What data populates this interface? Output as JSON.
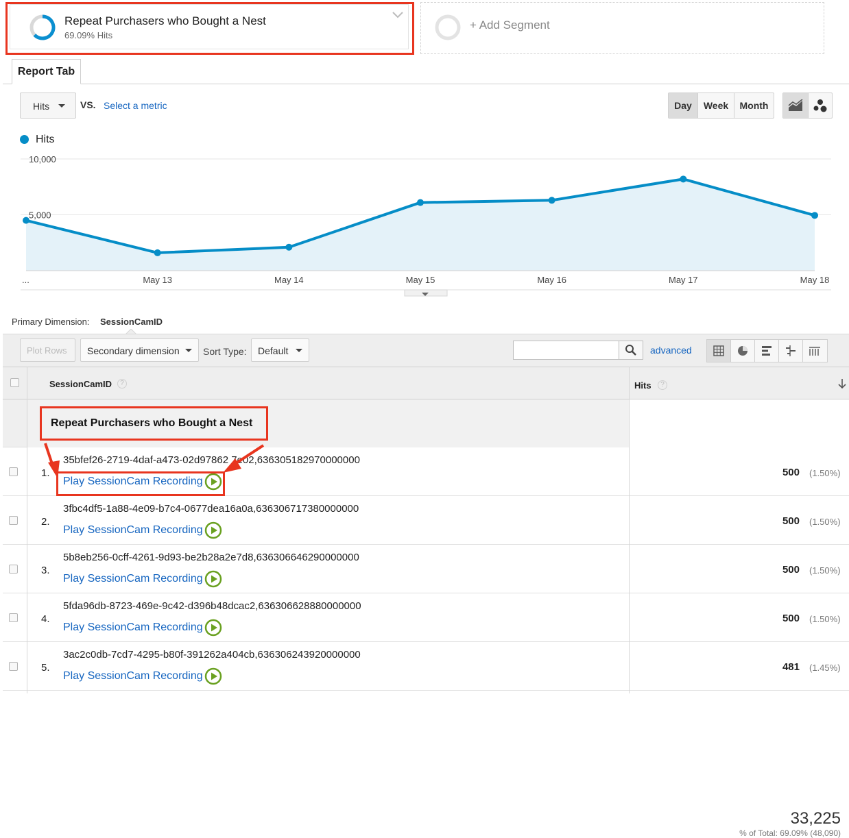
{
  "segment": {
    "title": "Repeat Purchasers who Bought a Nest",
    "subtitle": "69.09% Hits",
    "add_label": "+ Add Segment"
  },
  "tab": {
    "label": "Report Tab"
  },
  "controls": {
    "metric": "Hits",
    "vs": "VS.",
    "select_metric": "Select a metric",
    "periods": [
      "Day",
      "Week",
      "Month"
    ],
    "active_period": "Day"
  },
  "chart_data": {
    "type": "line",
    "title": "",
    "xlabel": "",
    "ylabel": "",
    "categories": [
      "...",
      "May 13",
      "May 14",
      "May 15",
      "May 16",
      "May 17",
      "May 18"
    ],
    "x_tick_labels": [
      "...",
      "May 13",
      "May 14",
      "May 15",
      "May 16",
      "May 17",
      "May 18"
    ],
    "y_tick_labels": [
      "10,000",
      "5,000"
    ],
    "ylim": [
      0,
      10000
    ],
    "series": [
      {
        "name": "Hits",
        "values": [
          4500,
          1600,
          2100,
          6100,
          6300,
          8200,
          4950
        ],
        "color": "#058dc7"
      }
    ],
    "grid": true,
    "legend": "top-left"
  },
  "primary_dimension": {
    "label": "Primary Dimension:",
    "value": "SessionCamID"
  },
  "toolbar": {
    "plot_rows": "Plot Rows",
    "secondary_dimension": "Secondary dimension",
    "sort_type_label": "Sort Type:",
    "sort_type_value": "Default",
    "advanced": "advanced"
  },
  "table": {
    "col_dimension": "SessionCamID",
    "col_metric": "Hits",
    "segment_row": {
      "title": "Repeat Purchasers who Bought a Nest",
      "total": "33,225",
      "total_pct": "% of Total: 69.09% (48,090)"
    },
    "rows": [
      {
        "index": "1.",
        "session_id": "35bfef26-2719-4daf-a473-02d97862 7e02,636305182970000000",
        "play_label": "Play SessionCam Recording",
        "hits": "500",
        "pct": "(1.50%)"
      },
      {
        "index": "2.",
        "session_id": "3fbc4df5-1a88-4e09-b7c4-0677dea16a0a,636306717380000000",
        "play_label": "Play SessionCam Recording",
        "hits": "500",
        "pct": "(1.50%)"
      },
      {
        "index": "3.",
        "session_id": "5b8eb256-0cff-4261-9d93-be2b28a2e7d8,636306646290000000",
        "play_label": "Play SessionCam Recording",
        "hits": "500",
        "pct": "(1.50%)"
      },
      {
        "index": "4.",
        "session_id": "5fda96db-8723-469e-9c42-d396b48dcac2,636306628880000000",
        "play_label": "Play SessionCam Recording",
        "hits": "500",
        "pct": "(1.50%)"
      },
      {
        "index": "5.",
        "session_id": "3ac2c0db-7cd7-4295-b80f-391262a404cb,636306243920000000",
        "play_label": "Play SessionCam Recording",
        "hits": "481",
        "pct": "(1.45%)"
      }
    ]
  },
  "colors": {
    "accent": "#058dc7",
    "link": "#1565c0",
    "highlight": "#e8351f",
    "play": "#6aa121"
  }
}
